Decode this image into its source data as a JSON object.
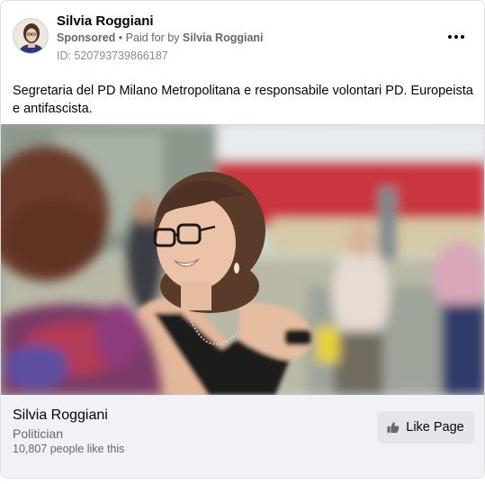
{
  "header": {
    "page_name": "Silvia Roggiani",
    "sponsored_label": "Sponsored",
    "separator": "•",
    "paid_for_label": "Paid for by",
    "payer": "Silvia Roggiani",
    "ad_id": "ID: 520793739866187",
    "more_icon": "more-horizontal-icon"
  },
  "post": {
    "text": "Segretaria del PD Milano Metropolitana e responsabile volontari PD. Europeista e antifascista."
  },
  "footer": {
    "page_name": "Silvia Roggiani",
    "category": "Politician",
    "likes": "10,807 people like this",
    "like_button_label": "Like Page",
    "like_icon": "thumbs-up-icon"
  },
  "colors": {
    "primary_text": "#050505",
    "secondary_text": "#65676b",
    "footer_bg": "#f0f2f5",
    "button_bg": "#e4e6eb"
  }
}
